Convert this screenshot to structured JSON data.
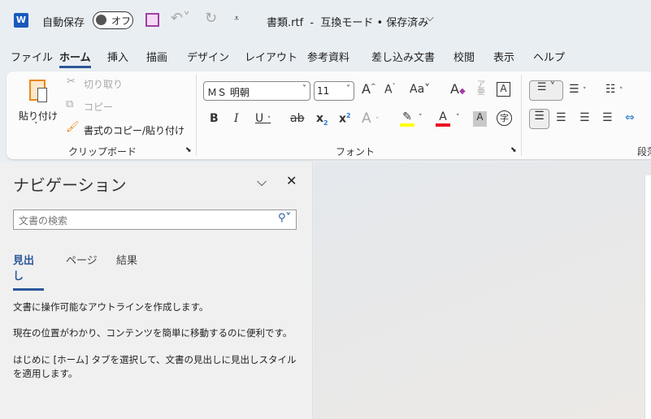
{
  "titlebar": {
    "autosave_label": "自動保存",
    "autosave_state": "オフ",
    "doc_title": "書類.rtf  -  互換モード • 保存済み"
  },
  "tabs": [
    "ファイル",
    "ホーム",
    "挿入",
    "描画",
    "デザイン",
    "レイアウト",
    "参考資料",
    "差し込み文書",
    "校閲",
    "表示",
    "ヘルプ"
  ],
  "clipboard": {
    "paste": "貼り付け",
    "cut": "切り取り",
    "copy": "コピー",
    "format_painter": "書式のコピー/貼り付け",
    "group": "クリップボード"
  },
  "font": {
    "name": "ＭＳ 明朝",
    "size": "11",
    "group": "フォント"
  },
  "paragraph": {
    "group": "段落"
  },
  "nav": {
    "title": "ナビゲーション",
    "search_placeholder": "文書の検索",
    "tabs": [
      "見出し",
      "ページ",
      "結果"
    ],
    "messages": [
      "文書に操作可能なアウトラインを作成します。",
      "現在の位置がわかり、コンテンツを簡単に移動するのに便利です。",
      "はじめに [ホーム] タブを選択して、文書の見出しに見出しスタイルを適用します。"
    ]
  },
  "colors": {
    "accent": "#2b579a",
    "highlight": "#ffff00",
    "font_color": "#e81123"
  }
}
